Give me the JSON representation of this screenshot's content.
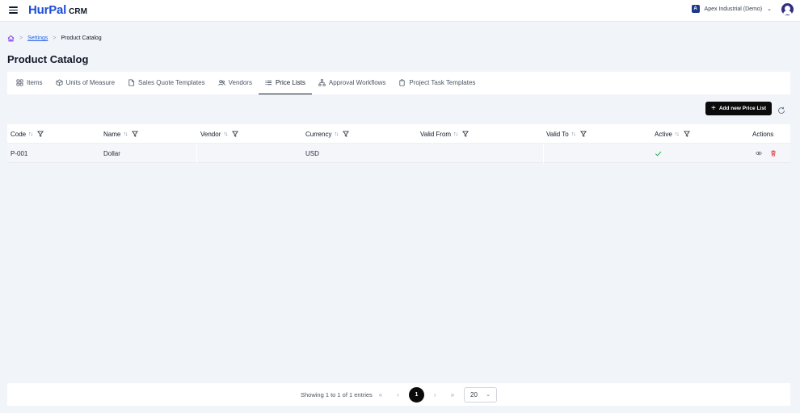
{
  "header": {
    "logo_main": "HurPal",
    "logo_sub": "CRM",
    "company_name": "Apex Industrial (Demo)",
    "company_badge": "A"
  },
  "breadcrumb": {
    "settings": "Settings",
    "current": "Product Catalog"
  },
  "page": {
    "title": "Product Catalog"
  },
  "tabs": [
    {
      "label": "Items",
      "icon": "grid-icon"
    },
    {
      "label": "Units of Measure",
      "icon": "box-icon"
    },
    {
      "label": "Sales Quote Templates",
      "icon": "document-icon"
    },
    {
      "label": "Vendors",
      "icon": "users-icon"
    },
    {
      "label": "Price Lists",
      "icon": "list-icon",
      "active": true
    },
    {
      "label": "Approval Workflows",
      "icon": "workflow-icon"
    },
    {
      "label": "Project Task Templates",
      "icon": "clipboard-icon"
    }
  ],
  "toolbar": {
    "add_label": "Add new Price List"
  },
  "table": {
    "headers": {
      "code": "Code",
      "name": "Name",
      "vendor": "Vendor",
      "currency": "Currency",
      "valid_from": "Valid From",
      "valid_to": "Valid To",
      "active": "Active",
      "actions": "Actions"
    },
    "rows": [
      {
        "code": "P-001",
        "name": "Dollar",
        "vendor": "",
        "currency": "USD",
        "valid_from": "",
        "valid_to": "",
        "active": true
      }
    ]
  },
  "footer": {
    "showing": "Showing 1 to 1 of 1 entries",
    "current_page": "1",
    "rows_per_page": "20"
  },
  "colors": {
    "brand": "#1d4ed8",
    "primary_button": "#0b0b0b",
    "active_check": "#16a34a",
    "delete": "#dc2626"
  }
}
